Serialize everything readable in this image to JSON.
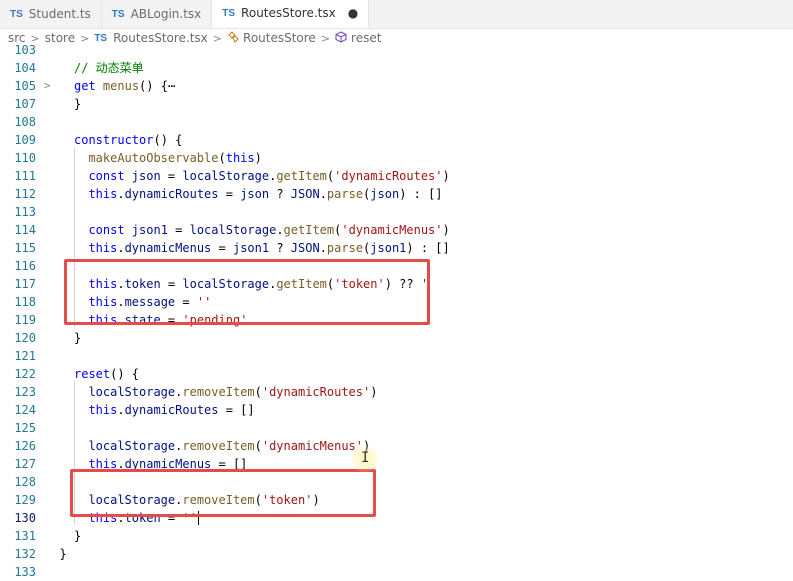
{
  "tabs": [
    {
      "badge": "TS",
      "label": "Student.ts",
      "active": false
    },
    {
      "badge": "TS",
      "label": "ABLogin.tsx",
      "active": false
    },
    {
      "badge": "TS",
      "label": "RoutesStore.tsx",
      "active": true,
      "modified_marker": "●"
    }
  ],
  "breadcrumb": {
    "items": [
      "src",
      "store",
      "RoutesStore.tsx",
      "RoutesStore",
      "reset"
    ],
    "file_badge": "TS",
    "class_icon": "class-symbol-icon",
    "method_icon": "method-cube-icon",
    "separator": ">"
  },
  "editor": {
    "current_line": "130",
    "lines": [
      {
        "n": "103",
        "fold": "",
        "code": ""
      },
      {
        "n": "104",
        "fold": "",
        "code": "// 动态菜单"
      },
      {
        "n": "105",
        "fold": ">",
        "code": "get menus() {⋯"
      },
      {
        "n": "107",
        "fold": "",
        "code": "}"
      },
      {
        "n": "108",
        "fold": "",
        "code": ""
      },
      {
        "n": "109",
        "fold": "",
        "code": "constructor() {"
      },
      {
        "n": "110",
        "fold": "",
        "code": "makeAutoObservable(this)"
      },
      {
        "n": "111",
        "fold": "",
        "code": "const json = localStorage.getItem('dynamicRoutes')"
      },
      {
        "n": "112",
        "fold": "",
        "code": "this.dynamicRoutes = json ? JSON.parse(json) : []"
      },
      {
        "n": "113",
        "fold": "",
        "code": ""
      },
      {
        "n": "114",
        "fold": "",
        "code": "const json1 = localStorage.getItem('dynamicMenus')"
      },
      {
        "n": "115",
        "fold": "",
        "code": "this.dynamicMenus = json1 ? JSON.parse(json1) : []"
      },
      {
        "n": "116",
        "fold": "",
        "code": ""
      },
      {
        "n": "117",
        "fold": "",
        "code": "this.token = localStorage.getItem('token') ?? '"
      },
      {
        "n": "118",
        "fold": "",
        "code": "this.message = ''"
      },
      {
        "n": "119",
        "fold": "",
        "code": "this.state = 'pending'"
      },
      {
        "n": "120",
        "fold": "",
        "code": "}"
      },
      {
        "n": "121",
        "fold": "",
        "code": ""
      },
      {
        "n": "122",
        "fold": "",
        "code": "reset() {"
      },
      {
        "n": "123",
        "fold": "",
        "code": "localStorage.removeItem('dynamicRoutes')"
      },
      {
        "n": "124",
        "fold": "",
        "code": "this.dynamicRoutes = []"
      },
      {
        "n": "125",
        "fold": "",
        "code": ""
      },
      {
        "n": "126",
        "fold": "",
        "code": "localStorage.removeItem('dynamicMenus')"
      },
      {
        "n": "127",
        "fold": "",
        "code": "this.dynamicMenus = []"
      },
      {
        "n": "128",
        "fold": "",
        "code": ""
      },
      {
        "n": "129",
        "fold": "",
        "code": "localStorage.removeItem('token')"
      },
      {
        "n": "130",
        "fold": "",
        "code": "this.token = ''"
      },
      {
        "n": "131",
        "fold": "",
        "code": "}"
      },
      {
        "n": "132",
        "fold": "",
        "code": "}"
      },
      {
        "n": "133",
        "fold": "",
        "code": ""
      }
    ]
  },
  "colors": {
    "keyword": "#0000ff",
    "string": "#a31515",
    "function": "#795e26",
    "variable": "#001080",
    "comment": "#008000",
    "line_number": "#237893",
    "highlight_box": "#e54b4b"
  }
}
